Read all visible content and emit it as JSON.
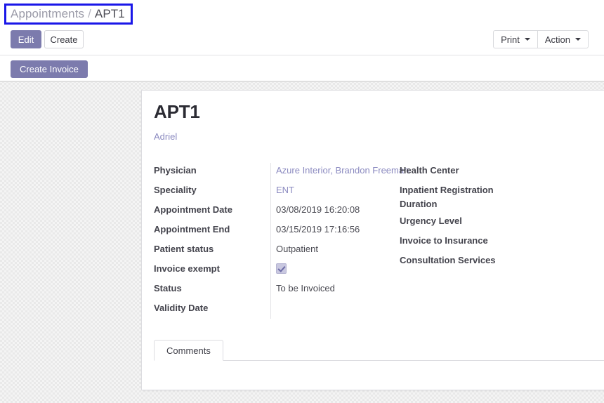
{
  "breadcrumb": {
    "parent": "Appointments",
    "separator": "/",
    "current": "APT1"
  },
  "controls": {
    "edit_label": "Edit",
    "create_label": "Create",
    "print_label": "Print",
    "action_label": "Action",
    "create_invoice_label": "Create Invoice"
  },
  "record": {
    "title": "APT1",
    "subtitle": "Adriel"
  },
  "form": {
    "left_fields": [
      {
        "label": "Physician",
        "value": "Azure Interior, Brandon Freeman",
        "style": "link"
      },
      {
        "label": "Speciality",
        "value": "ENT",
        "style": "link"
      },
      {
        "label": "Appointment Date",
        "value": "03/08/2019 16:20:08",
        "style": "text"
      },
      {
        "label": "Appointment End",
        "value": "03/15/2019 17:16:56",
        "style": "text"
      },
      {
        "label": "Patient status",
        "value": "Outpatient",
        "style": "text"
      },
      {
        "label": "Invoice exempt",
        "value": "",
        "style": "checkbox"
      },
      {
        "label": "Status",
        "value": "To be Invoiced",
        "style": "text"
      },
      {
        "label": "Validity Date",
        "value": "",
        "style": "text"
      }
    ],
    "right_fields": [
      {
        "label": "Health Center",
        "value": ""
      },
      {
        "label": "Inpatient Registration Duration",
        "value": ""
      },
      {
        "label": "Urgency Level",
        "value": ""
      },
      {
        "label": "Invoice to Insurance",
        "value": ""
      },
      {
        "label": "Consultation Services",
        "value": ""
      }
    ]
  },
  "notebook": {
    "tabs": [
      {
        "label": "Comments"
      }
    ]
  },
  "colors": {
    "primary": "#7c7bad",
    "link": "#8b8ac0",
    "annotation": "#1a17e8",
    "label": "#44444d"
  }
}
